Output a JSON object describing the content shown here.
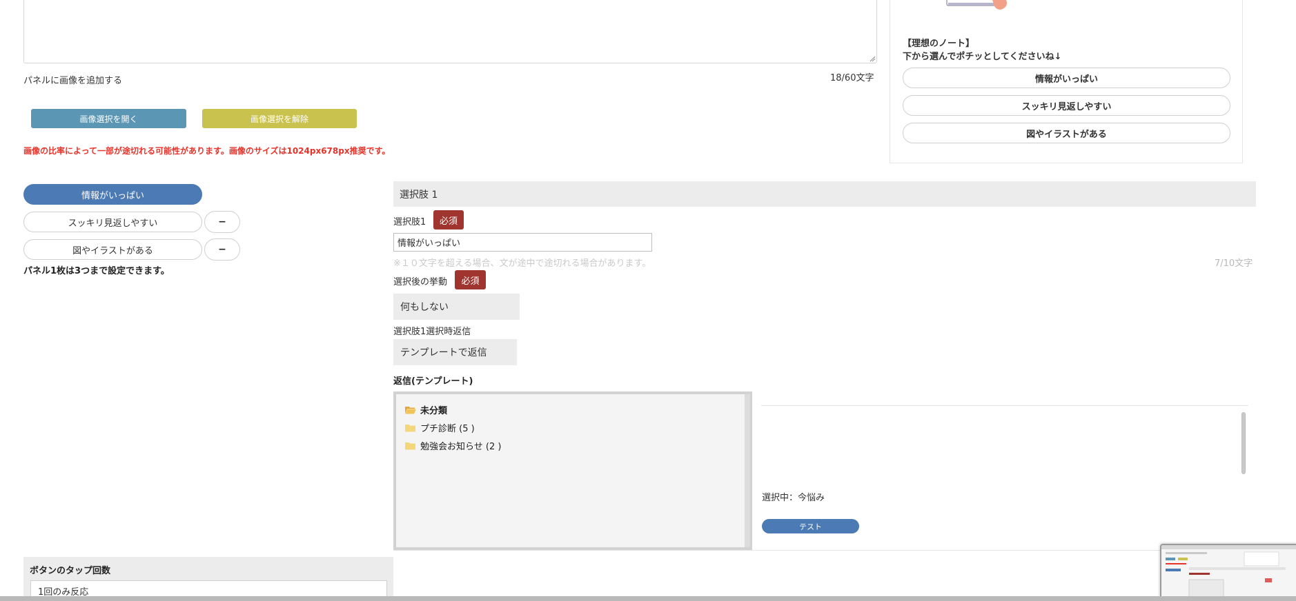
{
  "top_section": {
    "char_count": "18/60文字",
    "add_image_label": "パネルに画像を追加する",
    "open_image_button": "画像選択を開く",
    "clear_image_button": "画像選択を解除",
    "warning": "画像の比率によって一部が途切れる可能性があります。画像のサイズは1024px678px推奨です。"
  },
  "preview": {
    "heading": "【理想のノート】",
    "subheading": "下から選んでポチッとしてくださいね↓",
    "options": [
      "情報がいっぱい",
      "スッキリ見返しやすい",
      "図やイラストがある"
    ]
  },
  "left_choices": {
    "items": [
      "情報がいっぱい",
      "スッキリ見返しやすい",
      "図やイラストがある"
    ],
    "minus_label": "−",
    "note": "パネル1枚は3つまで設定できます。"
  },
  "choice_editor": {
    "section_title": "選択肢 1",
    "choice_label": "選択肢1",
    "required_badge": "必須",
    "choice_value": "情報がいっぱい",
    "hint": "※１０文字を超える場合、文が途中で途切れる場合があります。",
    "hint_count": "7/10文字",
    "action_label": "選択後の挙動",
    "action_value": "何もしない",
    "reply_label": "選択肢1選択時返信",
    "reply_value": "テンプレートで返信",
    "template_label": "返信(テンプレート)"
  },
  "folder_tree": {
    "items": [
      {
        "label": "未分類",
        "open": true
      },
      {
        "label": "プチ診断 (5 )",
        "open": false
      },
      {
        "label": "勉強会お知らせ (2 )",
        "open": false
      }
    ]
  },
  "template_preview": {
    "selected_text": "選択中：今悩み",
    "test_button": "テスト"
  },
  "tap_count": {
    "title": "ボタンのタップ回数",
    "value": "1回のみ反応"
  },
  "colors": {
    "blue_button": "#5b96b4",
    "yellow_button": "#c9c24f",
    "active_choice": "#4b7ab5",
    "required_badge": "#a0342f",
    "warning_text": "#e8332a"
  }
}
